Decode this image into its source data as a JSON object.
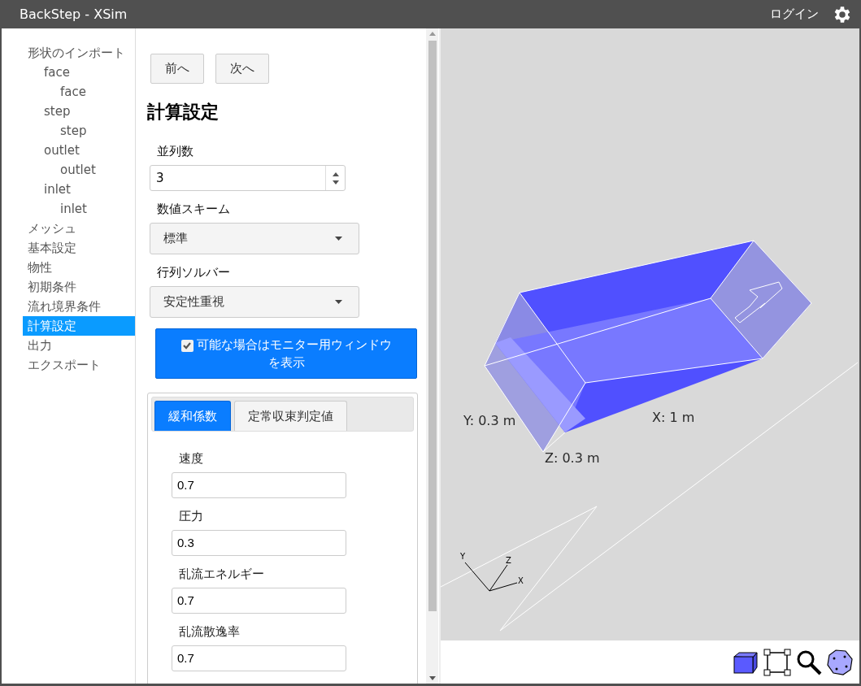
{
  "window": {
    "title": "BackStep - XSim",
    "login": "ログイン"
  },
  "sidebar": {
    "items": [
      {
        "label": "形状のインポート",
        "selected": false,
        "children": [
          {
            "label": "face",
            "selected": false,
            "children": [
              {
                "label": "face",
                "selected": false
              }
            ]
          },
          {
            "label": "step",
            "selected": false,
            "children": [
              {
                "label": "step",
                "selected": false
              }
            ]
          },
          {
            "label": "outlet",
            "selected": false,
            "children": [
              {
                "label": "outlet",
                "selected": false
              }
            ]
          },
          {
            "label": "inlet",
            "selected": false,
            "children": [
              {
                "label": "inlet",
                "selected": false
              }
            ]
          }
        ]
      },
      {
        "label": "メッシュ",
        "selected": false
      },
      {
        "label": "基本設定",
        "selected": false
      },
      {
        "label": "物性",
        "selected": false
      },
      {
        "label": "初期条件",
        "selected": false
      },
      {
        "label": "流れ境界条件",
        "selected": false
      },
      {
        "label": "計算設定",
        "selected": true
      },
      {
        "label": "出力",
        "selected": false
      },
      {
        "label": "エクスポート",
        "selected": false
      }
    ]
  },
  "nav_buttons": [
    "前へ",
    "次へ"
  ],
  "heading": "計算設定",
  "fields": [
    {
      "kind": "number",
      "label": "並列数",
      "value": "3"
    },
    {
      "kind": "select",
      "label": "数値スキーム",
      "value": "標準"
    },
    {
      "kind": "select",
      "label": "行列ソルバー",
      "value": "安定性重視"
    }
  ],
  "monitor_toggle": {
    "label": "可能な場合はモニター用ウィンドウを表示",
    "checked": true
  },
  "tabs": [
    {
      "label": "緩和係数",
      "selected": true
    },
    {
      "label": "定常収束判定値",
      "selected": false
    }
  ],
  "relaxation_fields": [
    {
      "label": "速度",
      "value": "0.7"
    },
    {
      "label": "圧力",
      "value": "0.3"
    },
    {
      "label": "乱流エネルギー",
      "value": "0.7"
    },
    {
      "label": "乱流散逸率",
      "value": "0.7"
    }
  ],
  "viewport": {
    "dimension_labels": [
      "Y: 0.3 m",
      "Z: 0.3 m",
      "X: 1 m"
    ],
    "axis_labels": [
      "Y",
      "Z",
      "X"
    ]
  }
}
